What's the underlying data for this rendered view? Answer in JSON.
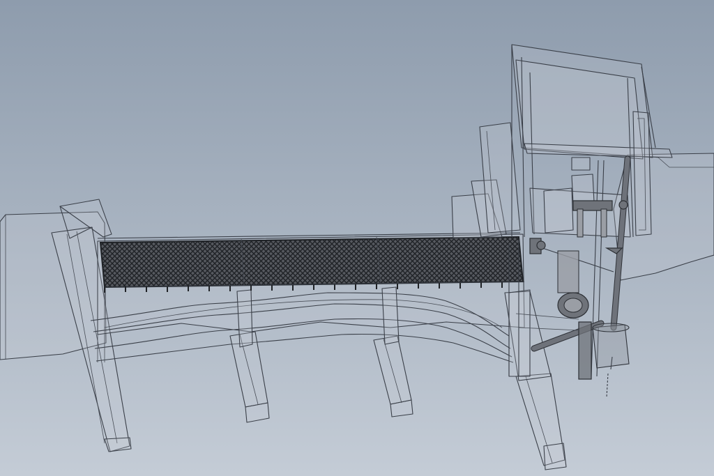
{
  "viewport": {
    "background_top": "#8e9cad",
    "background_bottom": "#c4ccd6"
  },
  "model": {
    "render_style": "transparent-wireframe",
    "edge_color": "#3a3f48",
    "grating_color": "#2a2d33",
    "component_color": "#6f737a"
  }
}
